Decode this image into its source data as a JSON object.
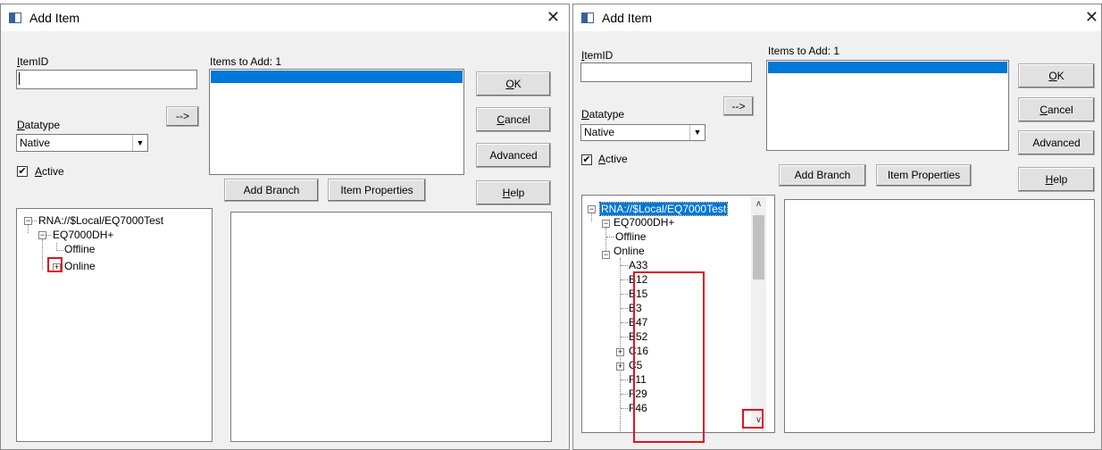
{
  "dialog_title": "Add Item",
  "itemid_label": "ItemID",
  "items_to_add_label": "Items to Add:",
  "items_to_add_count": "1",
  "arrow_button": "-->",
  "datatype_label": "Datatype",
  "datatype_value": "Native",
  "active_label": "Active",
  "active_checked": "✔",
  "buttons": {
    "ok": "OK",
    "cancel": "Cancel",
    "advanced": "Advanced",
    "help": "Help",
    "add_branch": "Add Branch",
    "item_properties": "Item Properties"
  },
  "tree_left": {
    "root": "RNA://$Local/EQ7000Test",
    "device": "EQ7000DH+",
    "offline": "Offline",
    "online": "Online"
  },
  "tree_right": {
    "root": "RNA://$Local/EQ7000Test",
    "device": "EQ7000DH+",
    "offline": "Offline",
    "online": "Online",
    "children": [
      "A33",
      "B12",
      "B15",
      "B3",
      "B47",
      "B52",
      "C16",
      "C5",
      "F11",
      "F29",
      "F46"
    ]
  },
  "icons": {
    "title": "window-icon",
    "close": "close-icon",
    "collapse": "minus-box-icon",
    "expand": "plus-box-icon",
    "scroll_up": "chevron-up-icon",
    "scroll_down": "chevron-down-icon"
  },
  "highlight_color": "#e0141e",
  "selection_color": "#0078d7"
}
